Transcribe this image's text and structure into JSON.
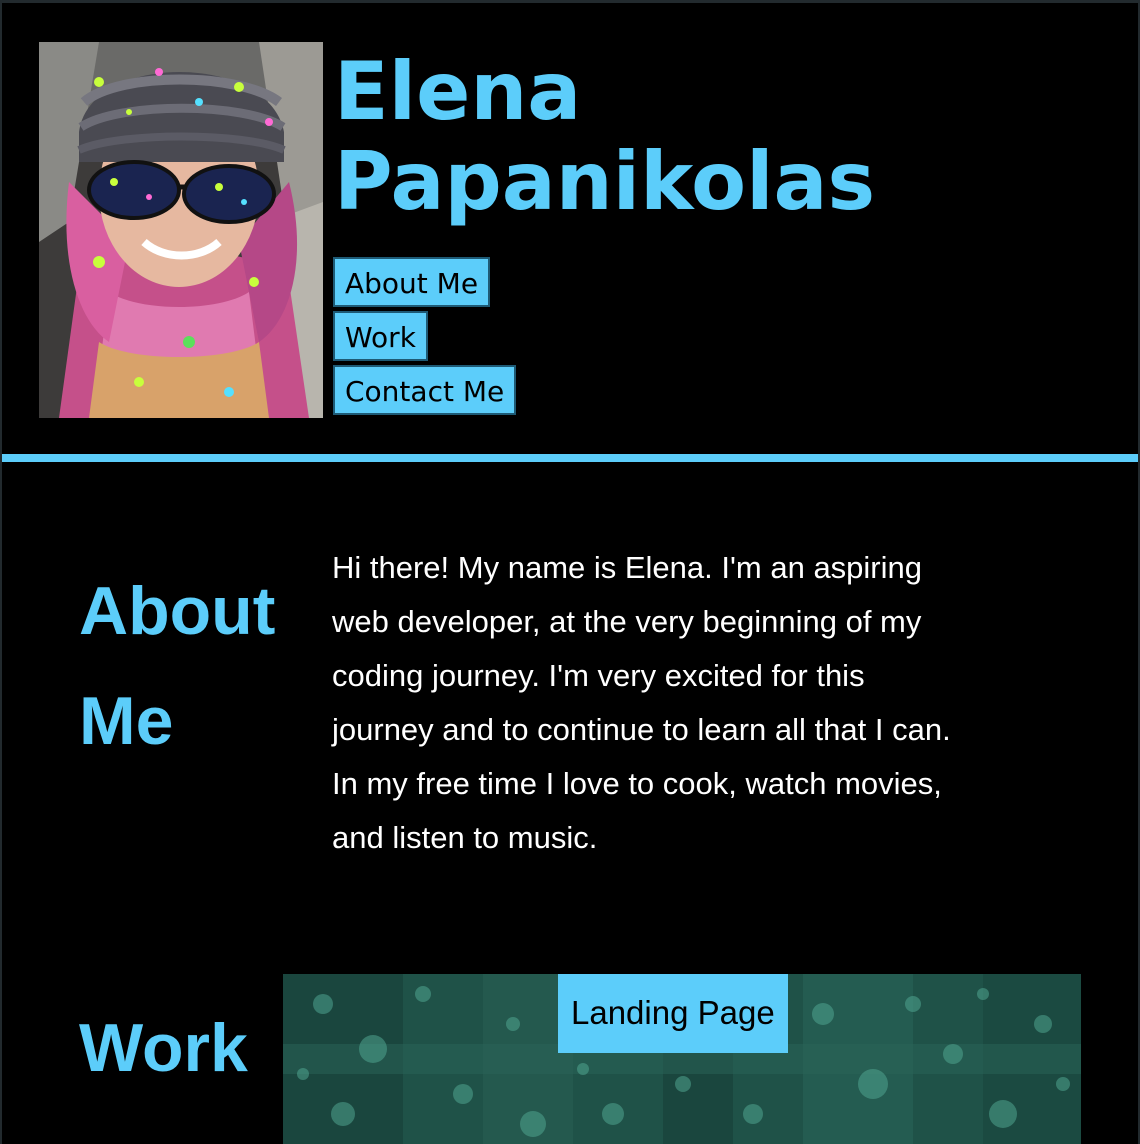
{
  "header": {
    "name_line1": "Elena",
    "name_line2": "Papanikolas",
    "photo_alt": "profile-photo"
  },
  "nav": {
    "items": [
      {
        "label": "About Me"
      },
      {
        "label": "Work"
      },
      {
        "label": "Contact Me"
      }
    ]
  },
  "about": {
    "heading_line1": "About",
    "heading_line2": "Me",
    "body_lines": [
      "Hi there! My name is Elena. I'm an aspiring",
      "web developer, at the very beginning of my",
      "coding journey. I'm very excited for this",
      "journey and to continue to learn all that I can.",
      "In my free time I love to cook, watch movies,",
      "and listen to music."
    ]
  },
  "work": {
    "heading": "Work",
    "projects": [
      {
        "label": "Landing Page"
      }
    ]
  },
  "colors": {
    "accent": "#5ccdfa",
    "background": "#000000",
    "text": "#ffffff",
    "card": "#1c4f45"
  }
}
